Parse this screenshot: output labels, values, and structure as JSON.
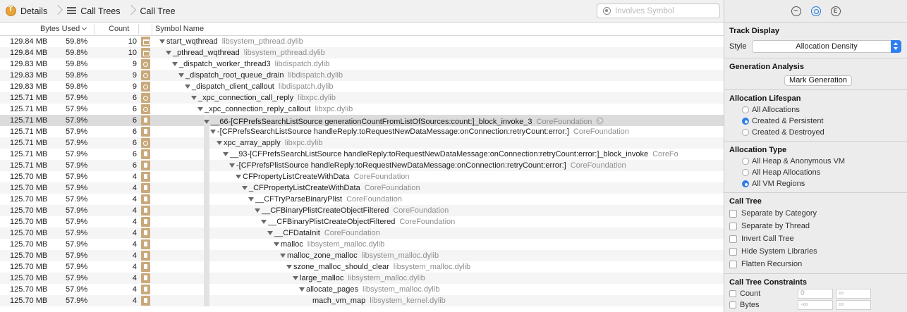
{
  "breadcrumb": {
    "items": [
      "Details",
      "Call Trees",
      "Call Tree"
    ]
  },
  "search": {
    "placeholder": "Involves Symbol",
    "value": ""
  },
  "columns": {
    "bytes_used": "Bytes Used",
    "count": "Count",
    "symbol_name": "Symbol Name"
  },
  "rows": [
    {
      "bytes": "129.84 MB",
      "pct": "59.8%",
      "count": "10",
      "icon": "lib",
      "indent": 0,
      "symbol": "start_wqthread",
      "lib": "libsystem_pthread.dylib"
    },
    {
      "bytes": "129.84 MB",
      "pct": "59.8%",
      "count": "10",
      "icon": "lib",
      "indent": 1,
      "symbol": "_pthread_wqthread",
      "lib": "libsystem_pthread.dylib"
    },
    {
      "bytes": "129.83 MB",
      "pct": "59.8%",
      "count": "9",
      "icon": "gear",
      "indent": 2,
      "symbol": "_dispatch_worker_thread3",
      "lib": "libdispatch.dylib"
    },
    {
      "bytes": "129.83 MB",
      "pct": "59.8%",
      "count": "9",
      "icon": "gear",
      "indent": 3,
      "symbol": "_dispatch_root_queue_drain",
      "lib": "libdispatch.dylib"
    },
    {
      "bytes": "129.83 MB",
      "pct": "59.8%",
      "count": "9",
      "icon": "gear",
      "indent": 4,
      "symbol": "_dispatch_client_callout",
      "lib": "libdispatch.dylib"
    },
    {
      "bytes": "125.71 MB",
      "pct": "57.9%",
      "count": "6",
      "icon": "gear",
      "indent": 5,
      "symbol": "_xpc_connection_call_reply",
      "lib": "libxpc.dylib"
    },
    {
      "bytes": "125.71 MB",
      "pct": "57.9%",
      "count": "6",
      "icon": "gear",
      "indent": 6,
      "symbol": "_xpc_connection_reply_callout",
      "lib": "libxpc.dylib"
    },
    {
      "bytes": "125.71 MB",
      "pct": "57.9%",
      "count": "6",
      "icon": "doc",
      "indent": 7,
      "symbol": "__66-[CFPrefsSearchListSource generationCountFromListOfSources:count:]_block_invoke_3",
      "lib": "CoreFoundation",
      "selected": true
    },
    {
      "bytes": "125.71 MB",
      "pct": "57.9%",
      "count": "6",
      "icon": "doc",
      "indent": 8,
      "symbol": "-[CFPrefsSearchListSource handleReply:toRequestNewDataMessage:onConnection:retryCount:error:]",
      "lib": "CoreFoundation"
    },
    {
      "bytes": "125.71 MB",
      "pct": "57.9%",
      "count": "6",
      "icon": "gear",
      "indent": 9,
      "symbol": "xpc_array_apply",
      "lib": "libxpc.dylib"
    },
    {
      "bytes": "125.71 MB",
      "pct": "57.9%",
      "count": "6",
      "icon": "doc",
      "indent": 10,
      "symbol": "__93-[CFPrefsSearchListSource handleReply:toRequestNewDataMessage:onConnection:retryCount:error:]_block_invoke",
      "lib": "CoreFo"
    },
    {
      "bytes": "125.71 MB",
      "pct": "57.9%",
      "count": "6",
      "icon": "doc",
      "indent": 11,
      "symbol": "-[CFPrefsPlistSource handleReply:toRequestNewDataMessage:onConnection:retryCount:error:]",
      "lib": "CoreFoundation"
    },
    {
      "bytes": "125.70 MB",
      "pct": "57.9%",
      "count": "4",
      "icon": "doc",
      "indent": 12,
      "symbol": "CFPropertyListCreateWithData",
      "lib": "CoreFoundation"
    },
    {
      "bytes": "125.70 MB",
      "pct": "57.9%",
      "count": "4",
      "icon": "doc",
      "indent": 13,
      "symbol": "_CFPropertyListCreateWithData",
      "lib": "CoreFoundation"
    },
    {
      "bytes": "125.70 MB",
      "pct": "57.9%",
      "count": "4",
      "icon": "doc",
      "indent": 14,
      "symbol": "__CFTryParseBinaryPlist",
      "lib": "CoreFoundation"
    },
    {
      "bytes": "125.70 MB",
      "pct": "57.9%",
      "count": "4",
      "icon": "doc",
      "indent": 15,
      "symbol": "__CFBinaryPlistCreateObjectFiltered",
      "lib": "CoreFoundation"
    },
    {
      "bytes": "125.70 MB",
      "pct": "57.9%",
      "count": "4",
      "icon": "doc",
      "indent": 16,
      "symbol": "__CFBinaryPlistCreateObjectFiltered",
      "lib": "CoreFoundation"
    },
    {
      "bytes": "125.70 MB",
      "pct": "57.9%",
      "count": "4",
      "icon": "doc",
      "indent": 17,
      "symbol": "__CFDataInit",
      "lib": "CoreFoundation"
    },
    {
      "bytes": "125.70 MB",
      "pct": "57.9%",
      "count": "4",
      "icon": "doc",
      "indent": 18,
      "symbol": "malloc",
      "lib": "libsystem_malloc.dylib"
    },
    {
      "bytes": "125.70 MB",
      "pct": "57.9%",
      "count": "4",
      "icon": "doc",
      "indent": 19,
      "symbol": "malloc_zone_malloc",
      "lib": "libsystem_malloc.dylib"
    },
    {
      "bytes": "125.70 MB",
      "pct": "57.9%",
      "count": "4",
      "icon": "doc",
      "indent": 20,
      "symbol": "szone_malloc_should_clear",
      "lib": "libsystem_malloc.dylib"
    },
    {
      "bytes": "125.70 MB",
      "pct": "57.9%",
      "count": "4",
      "icon": "doc",
      "indent": 21,
      "symbol": "large_malloc",
      "lib": "libsystem_malloc.dylib"
    },
    {
      "bytes": "125.70 MB",
      "pct": "57.9%",
      "count": "4",
      "icon": "doc",
      "indent": 22,
      "symbol": "allocate_pages",
      "lib": "libsystem_malloc.dylib"
    },
    {
      "bytes": "125.70 MB",
      "pct": "57.9%",
      "count": "4",
      "icon": "doc",
      "indent": 23,
      "symbol": "mach_vm_map",
      "lib": "libsystem_kernel.dylib",
      "leaf": true
    }
  ],
  "inspector": {
    "tabs": [
      "wave-icon",
      "gear-icon",
      "extended-icon"
    ],
    "tab_e_label": "E",
    "track_display": {
      "title": "Track Display",
      "style_label": "Style",
      "style_value": "Allocation Density"
    },
    "generation": {
      "title": "Generation Analysis",
      "button": "Mark Generation"
    },
    "lifespan": {
      "title": "Allocation Lifespan",
      "options": [
        {
          "label": "All Allocations",
          "selected": false
        },
        {
          "label": "Created & Persistent",
          "selected": true
        },
        {
          "label": "Created & Destroyed",
          "selected": false
        }
      ]
    },
    "alloc_type": {
      "title": "Allocation Type",
      "options": [
        {
          "label": "All Heap & Anonymous VM",
          "selected": false
        },
        {
          "label": "All Heap Allocations",
          "selected": false
        },
        {
          "label": "All VM Regions",
          "selected": true
        }
      ]
    },
    "call_tree": {
      "title": "Call Tree",
      "options": [
        "Separate by Category",
        "Separate by Thread",
        "Invert Call Tree",
        "Hide System Libraries",
        "Flatten Recursion"
      ]
    },
    "constraints": {
      "title": "Call Tree Constraints",
      "rows": [
        {
          "label": "Count",
          "min": "0",
          "max": "∞"
        },
        {
          "label": "Bytes",
          "min": "-∞",
          "max": "∞"
        }
      ]
    }
  },
  "colors": {
    "accent": "#2f7ff0",
    "selected_row": "#dcdcdc",
    "icon_tan": "#c9a97b"
  }
}
